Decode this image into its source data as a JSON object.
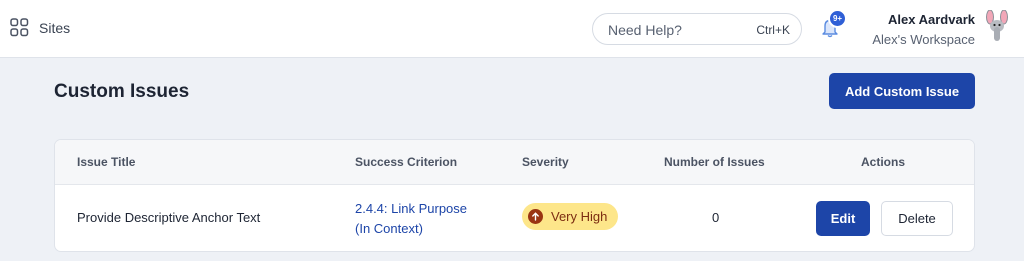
{
  "header": {
    "nav_icon": "grid-icon",
    "sites_label": "Sites",
    "help": {
      "placeholder": "Need Help?",
      "shortcut": "Ctrl+K"
    },
    "notifications": {
      "icon": "bell-icon",
      "badge": "9+"
    },
    "user": {
      "name": "Alex Aardvark",
      "workspace": "Alex's Workspace",
      "avatar_icon": "aardvark-avatar-icon"
    }
  },
  "page": {
    "title": "Custom Issues",
    "add_button": "Add Custom Issue"
  },
  "table": {
    "columns": [
      "Issue Title",
      "Success Criterion",
      "Severity",
      "Number of Issues",
      "Actions"
    ],
    "rows": [
      {
        "title": "Provide Descriptive Anchor Text",
        "criterion_line1": "2.4.4: Link Purpose",
        "criterion_line2": "(In Context)",
        "severity": "Very High",
        "severity_icon": "arrow-up-icon",
        "count": "0",
        "edit_label": "Edit",
        "delete_label": "Delete"
      }
    ]
  },
  "colors": {
    "primary": "#1d45a8",
    "badge": "#2f5fd6",
    "severity_bg": "#fde68a",
    "severity_icon": "#9a3412",
    "background": "#eef1f6"
  }
}
